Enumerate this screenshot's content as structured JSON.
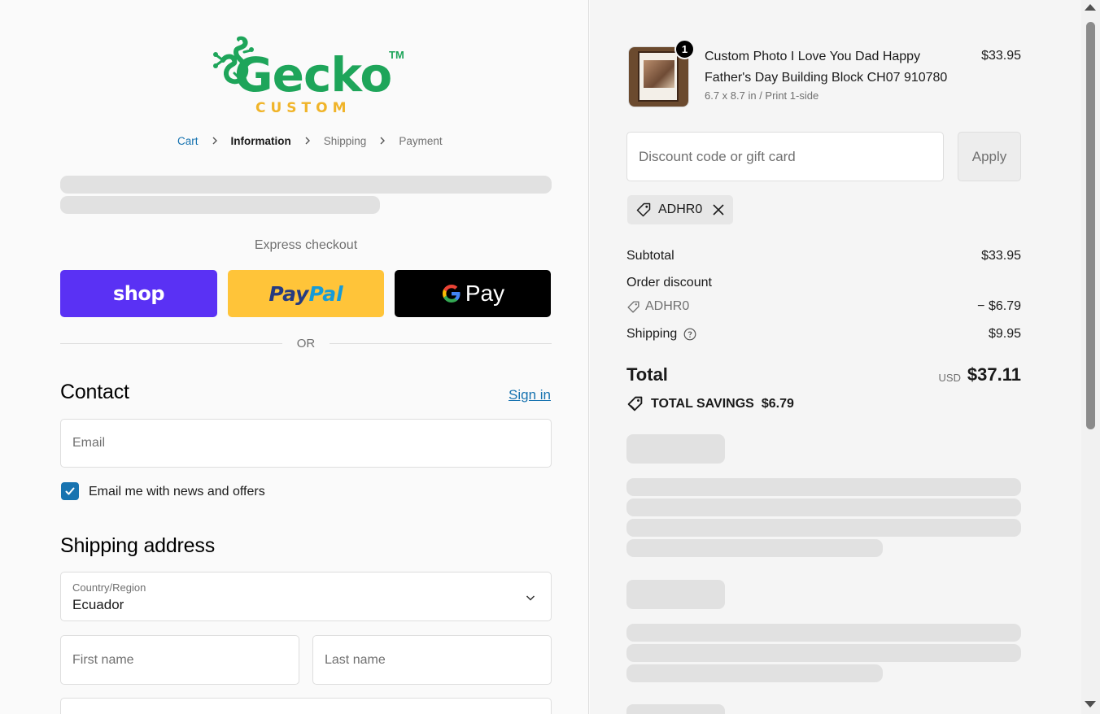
{
  "logo": {
    "wordmark": "Gecko",
    "tagline": "CUSTOM",
    "tm": "TM"
  },
  "breadcrumb": [
    "Cart",
    "Information",
    "Shipping",
    "Payment"
  ],
  "express": {
    "title": "Express checkout",
    "shop_label": "shop",
    "paypal_part1": "Pay",
    "paypal_part2": "Pal",
    "gpay_label": "Pay",
    "or_text": "OR"
  },
  "contact": {
    "heading": "Contact",
    "signin": "Sign in",
    "email_placeholder": "Email",
    "newsletter_label": "Email me with news and offers",
    "newsletter_checked": true
  },
  "shipping": {
    "heading": "Shipping address",
    "country_label": "Country/Region",
    "country_value": "Ecuador",
    "first_name_placeholder": "First name",
    "last_name_placeholder": "Last name"
  },
  "order": {
    "product": {
      "title": "Custom Photo I Love You Dad Happy Father's Day Building Block CH07 910780",
      "variant": "6.7 x 8.7 in / Print 1-side",
      "price": "$33.95",
      "quantity": "1"
    },
    "discount_placeholder": "Discount code or gift card",
    "apply_label": "Apply",
    "applied_code": "ADHR0",
    "subtotal_label": "Subtotal",
    "subtotal_value": "$33.95",
    "order_discount_label": "Order discount",
    "discount_code": "ADHR0",
    "discount_value": "− $6.79",
    "shipping_label": "Shipping",
    "shipping_value": "$9.95",
    "total_label": "Total",
    "currency": "USD",
    "total_value": "$37.11",
    "savings_label": "TOTAL SAVINGS",
    "savings_value": "$6.79"
  },
  "colors": {
    "shop": "#5a31f4",
    "paypal": "#ffc439",
    "gpay": "#000000",
    "link": "#1773b0",
    "brand_green": "#1ea55a",
    "brand_yellow": "#f0b429"
  }
}
